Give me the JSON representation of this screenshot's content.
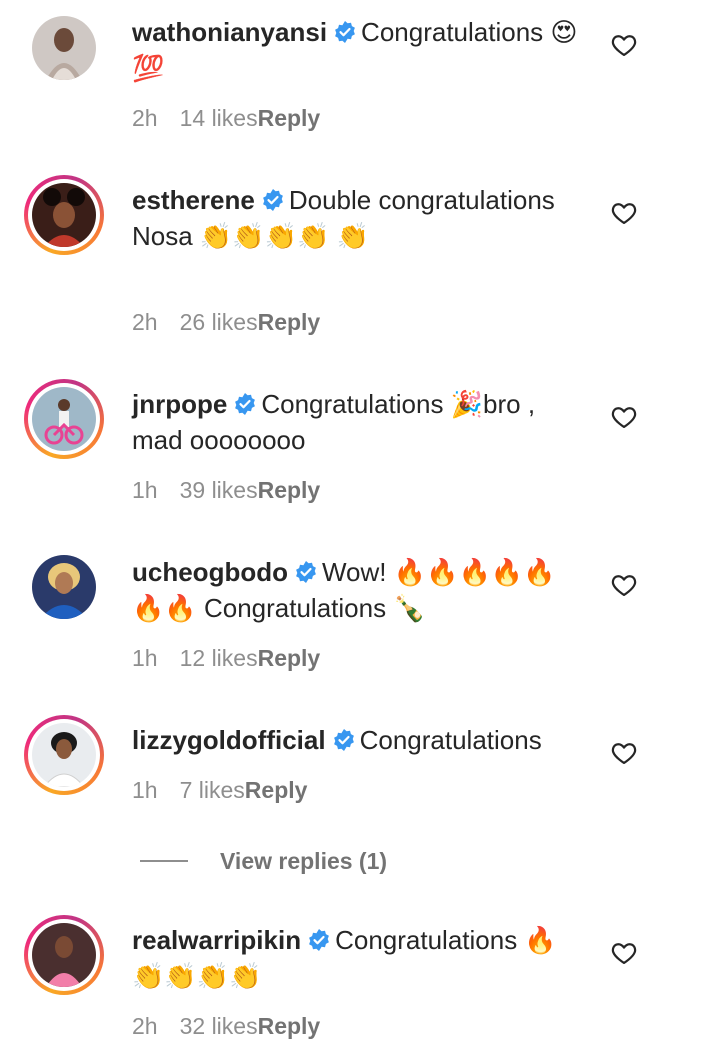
{
  "comments": [
    {
      "username": "wathonianyansi",
      "text": "Congratulations 😍💯",
      "time": "2h",
      "likes": "14 likes",
      "reply": "Reply"
    },
    {
      "username": "estherene",
      "text": "Double congratulations Nosa 👏👏👏👏 👏",
      "time": "2h",
      "likes": "26 likes",
      "reply": "Reply"
    },
    {
      "username": "jnrpope",
      "text": "Congratulations 🎉bro , mad oooooooo",
      "time": "1h",
      "likes": "39 likes",
      "reply": "Reply"
    },
    {
      "username": "ucheogbodo",
      "text": "Wow! 🔥🔥🔥🔥🔥 🔥🔥 Congratulations 🍾",
      "time": "1h",
      "likes": "12 likes",
      "reply": "Reply"
    },
    {
      "username": "lizzygoldofficial",
      "text": "Congratulations",
      "time": "1h",
      "likes": "7 likes",
      "reply": "Reply"
    },
    {
      "username": "realwarripikin",
      "text": "Congratulations 🔥👏👏👏👏",
      "time": "2h",
      "likes": "32 likes",
      "reply": "Reply"
    }
  ],
  "view_replies": "View replies (1)",
  "icons": {
    "verified": "verified-badge-icon",
    "like": "heart-outline-icon"
  },
  "colors": {
    "verified": "#3897f0",
    "story_ring_start": "#f9a825",
    "story_ring_end": "#c13584",
    "muted_text": "#8e8e8e"
  }
}
